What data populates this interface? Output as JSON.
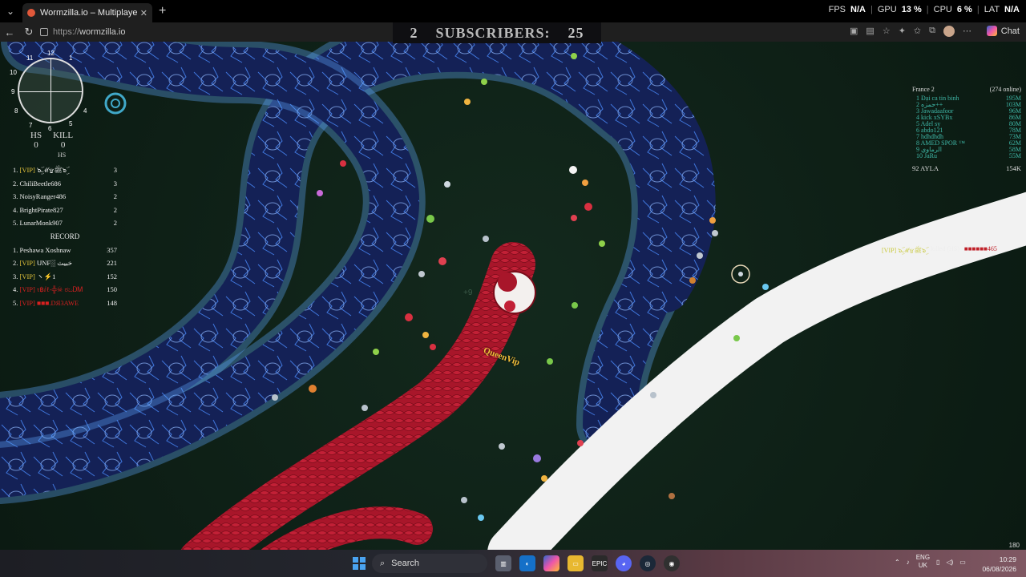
{
  "browser": {
    "tab_title": "Wormzilla.io – Multiplayer Snake G",
    "url_scheme": "https://",
    "url_host": "wormzilla.io",
    "chat_label": "Chat"
  },
  "hud": {
    "fps_label": "FPS",
    "fps_value": "N/A",
    "gpu_label": "GPU",
    "gpu_value": "13 %",
    "cpu_label": "CPU",
    "cpu_value": "6 %",
    "lat_label": "LAT",
    "lat_value": "N/A"
  },
  "banner": {
    "count": "2",
    "label": "SUBSCRIBERS:",
    "target": "25"
  },
  "minimap": {
    "numbers": [
      "12",
      "11",
      "1",
      "10",
      "9",
      "8",
      "7",
      "6",
      "5",
      "4"
    ]
  },
  "stats": {
    "hs_label": "HS",
    "kill_label": "KILL",
    "hs_value": "0",
    "kill_value": "0",
    "sub_label": "HS"
  },
  "session_list": [
    {
      "rank": "1.",
      "tag": "[VIP]",
      "name": " ๖ۣۜℳ۩ﷺ๖ۣۜ",
      "score": "3",
      "style": "vip"
    },
    {
      "rank": "2.",
      "tag": "",
      "name": "ChiliBeetle686",
      "score": "3",
      "style": ""
    },
    {
      "rank": "3.",
      "tag": "",
      "name": "NoisyRanger486",
      "score": "2",
      "style": ""
    },
    {
      "rank": "4.",
      "tag": "",
      "name": "BrightPirate827",
      "score": "2",
      "style": ""
    },
    {
      "rank": "5.",
      "tag": "",
      "name": "LunarMonk907",
      "score": "2",
      "style": ""
    }
  ],
  "record_label": "RECORD",
  "record_list": [
    {
      "rank": "1.",
      "tag": "",
      "name": "Peshawa Xoshnaw",
      "score": "357",
      "style": ""
    },
    {
      "rank": "2.",
      "tag": "[VIP]",
      "name": " ᑌNF░ خبيث",
      "score": "221",
      "style": "vip"
    },
    {
      "rank": "3.",
      "tag": "[VIP]",
      "name": " ヽ⚡1",
      "score": "152",
      "style": "vip"
    },
    {
      "rank": "4.",
      "tag": "[VIP]",
      "name": " τ฿ⅈℓ-╬☠ ಠಒᎠᎷ",
      "score": "150",
      "style": "red"
    },
    {
      "rank": "5.",
      "tag": "[VIP]",
      "name": " ■■■.DЯ3AWE",
      "score": "148",
      "style": "red"
    }
  ],
  "leaderboard": {
    "server": "France 2",
    "online": "(274 online)",
    "rows": [
      {
        "rank": "1",
        "name": "Đại ca tin binh",
        "score": "195M"
      },
      {
        "rank": "2",
        "name": "حمزه++",
        "score": "103M"
      },
      {
        "rank": "3",
        "name": "Jawadaafoor",
        "score": "96M"
      },
      {
        "rank": "4",
        "name": "kick xSYBx",
        "score": "86M"
      },
      {
        "rank": "5",
        "name": "Adel sy",
        "score": "80M"
      },
      {
        "rank": "6",
        "name": "abdo121",
        "score": "78M"
      },
      {
        "rank": "7",
        "name": "hdhdhdh",
        "score": "73M"
      },
      {
        "rank": "8",
        "name": "AMED SPOR ™",
        "score": "62M"
      },
      {
        "rank": "9",
        "name": "الرماوي",
        "score": "58M"
      },
      {
        "rank": "10",
        "name": "JaRu",
        "score": "55M"
      }
    ],
    "me_rank": "92",
    "me_name": "AYLA",
    "me_score": "154K"
  },
  "killfeed": {
    "killer": "[VIP] ๖ۣۜℳ۩ﷺ๖ۣۜ",
    "action": "killed (HS)",
    "victim": "■■■■■■465"
  },
  "player": {
    "nickname": "QueenVip",
    "gain": "+9"
  },
  "corner_counter": "180",
  "taskbar": {
    "search_label": "Search",
    "lang_top": "ENG",
    "lang_bottom": "UK",
    "time": "10:29",
    "date": "06/08/2026",
    "apps": [
      "file-explorer",
      "edge",
      "copilot",
      "folder",
      "epic",
      "discord",
      "steam",
      "obs"
    ]
  },
  "colors": {
    "snake_blue": "#1b2c6a",
    "snake_red": "#b0182a",
    "snake_white": "#f2f2f2",
    "vip_gold": "#e2c23a",
    "board_teal": "#3fb8a8"
  }
}
